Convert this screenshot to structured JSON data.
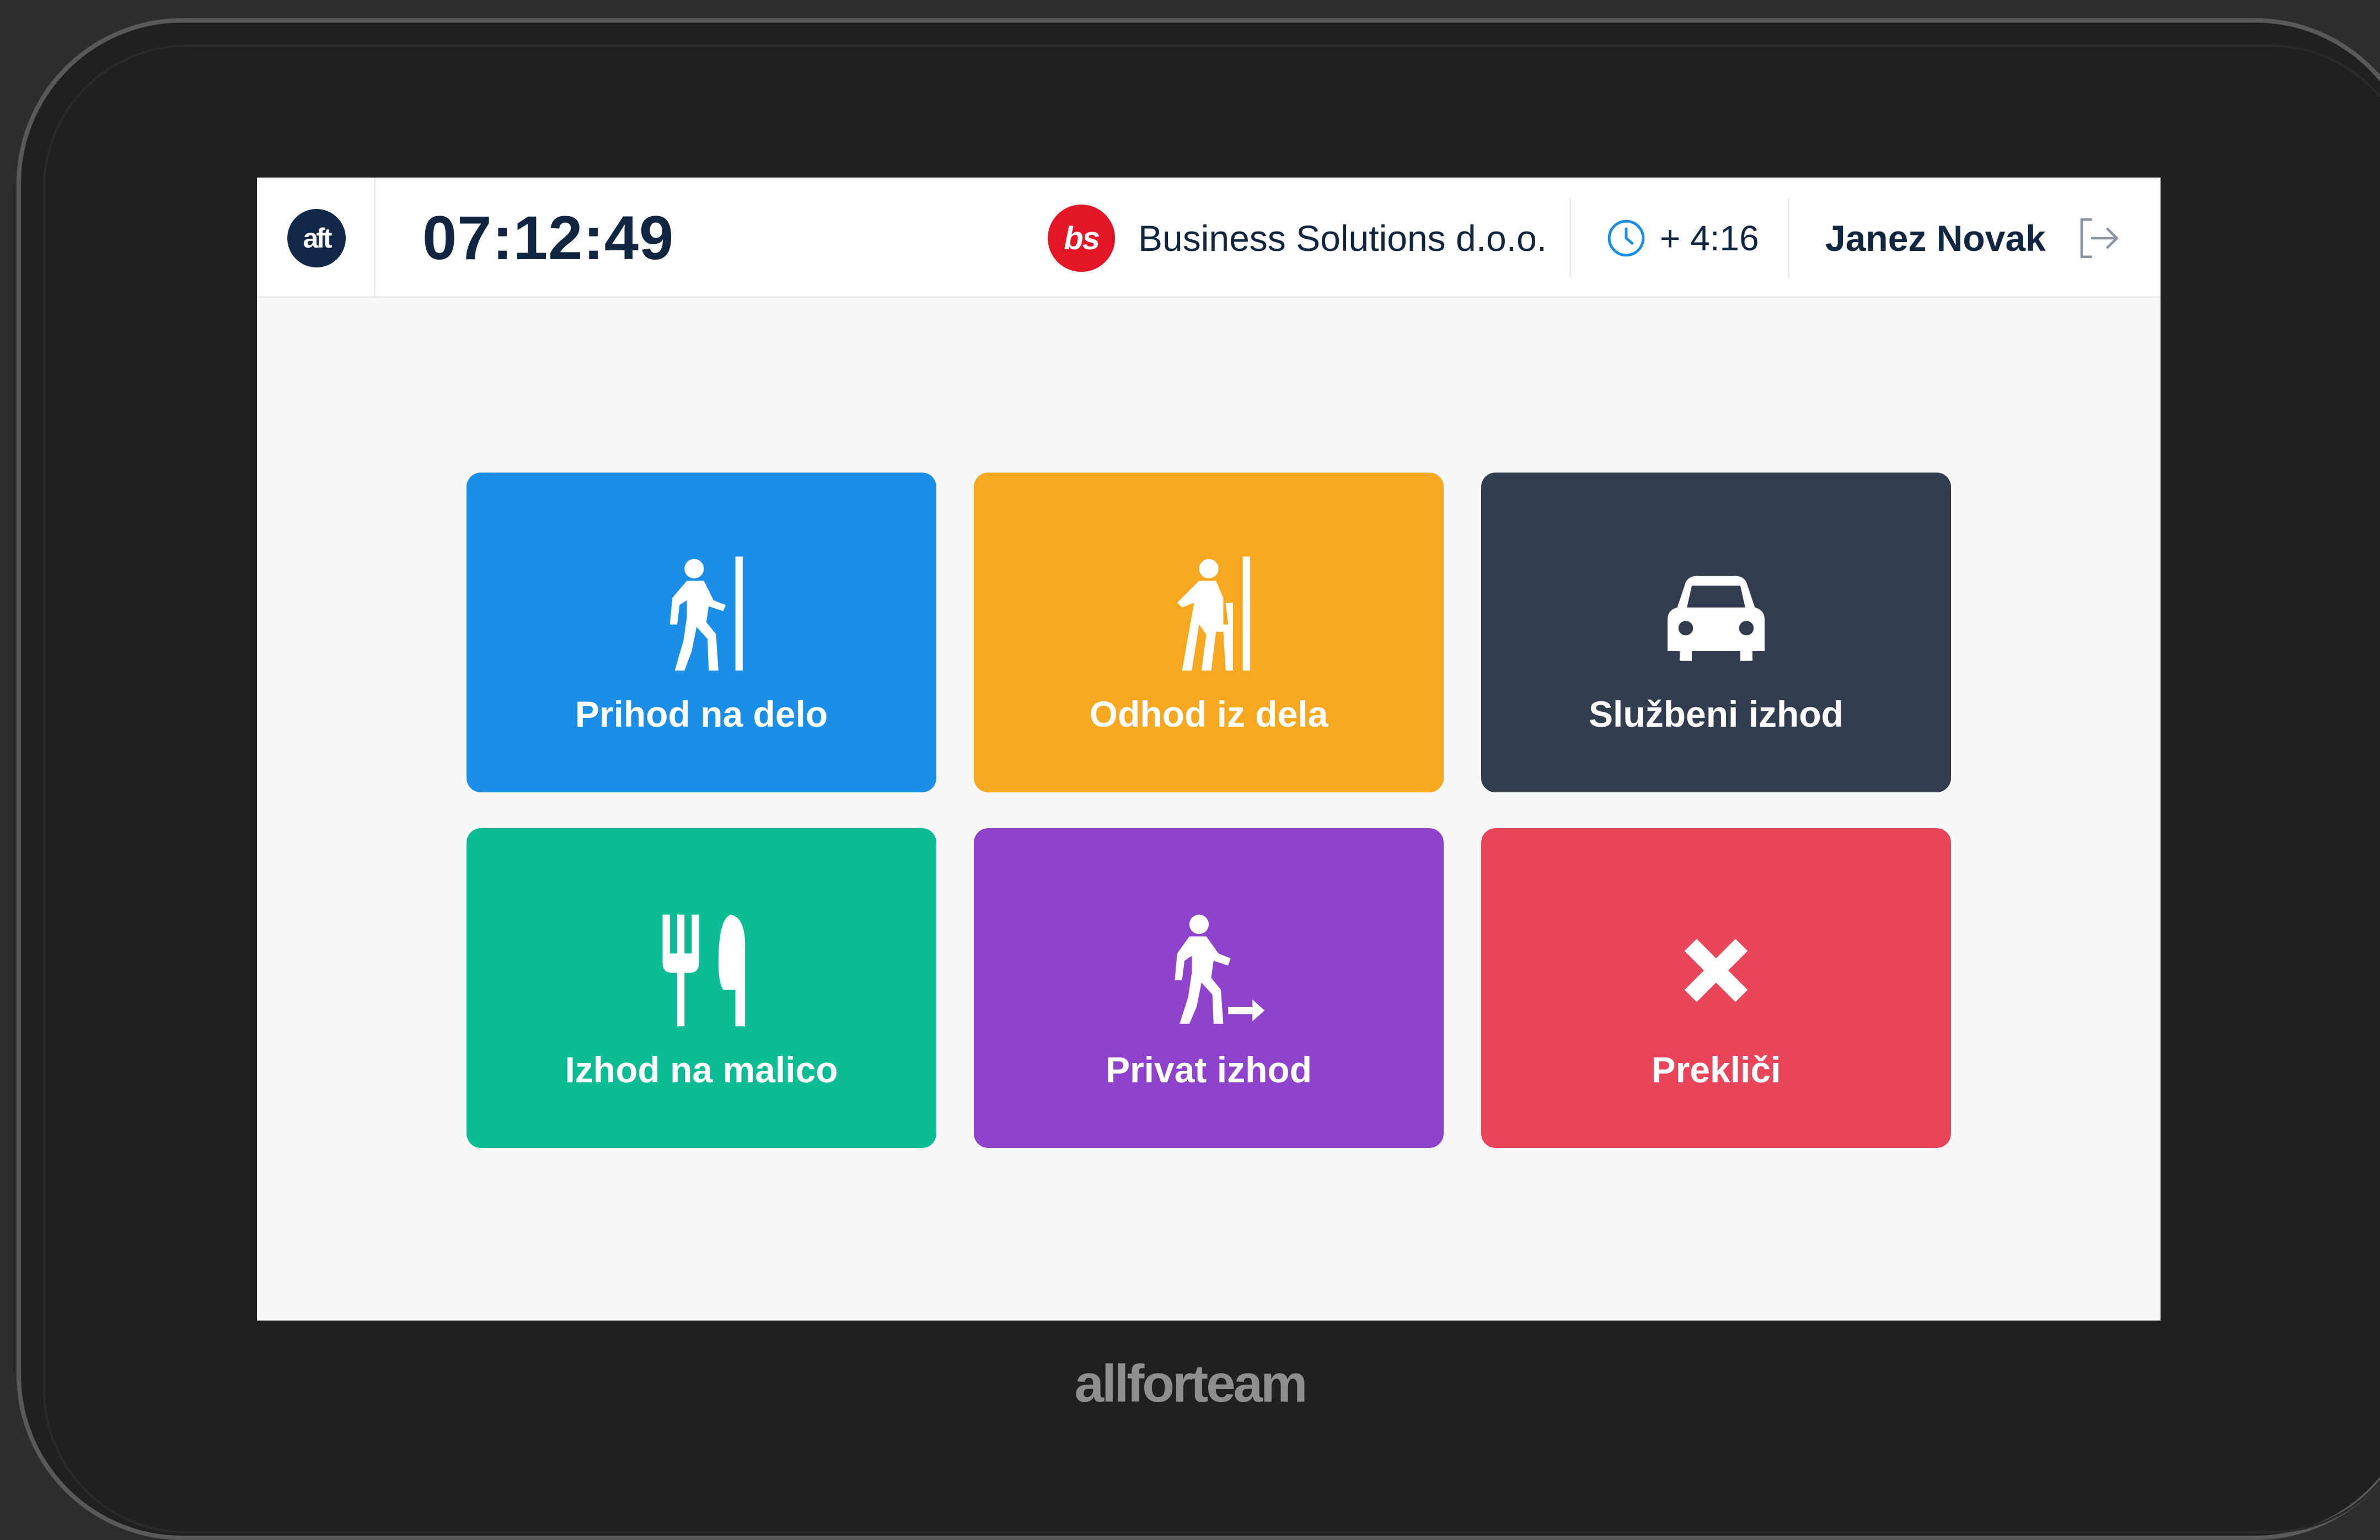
{
  "device": {
    "brand": "allforteam"
  },
  "header": {
    "logo_text": "aft",
    "time": "07:12:49",
    "company_logo_text": "bs",
    "company_name": "Business Solutions d.o.o.",
    "time_balance": "+ 4:16",
    "user_name": "Janez Novak"
  },
  "tiles": [
    {
      "label": "Prihod na delo",
      "icon": "walk-in-icon",
      "color": "#1b8fe7"
    },
    {
      "label": "Odhod iz dela",
      "icon": "walk-out-icon",
      "color": "#f6a821"
    },
    {
      "label": "Službeni izhod",
      "icon": "car-icon",
      "color": "#323c4f"
    },
    {
      "label": "Izhod na malico",
      "icon": "fork-knife-icon",
      "color": "#0bbc94"
    },
    {
      "label": "Privat izhod",
      "icon": "walk-away-icon",
      "color": "#8f42cb"
    },
    {
      "label": "Prekliči",
      "icon": "close-icon",
      "color": "#e9455a"
    }
  ]
}
